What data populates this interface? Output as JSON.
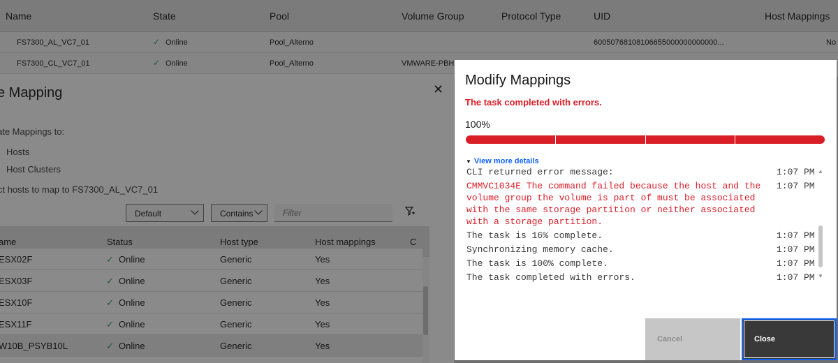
{
  "volumes_table": {
    "columns": [
      "Name",
      "State",
      "Pool",
      "Volume Group",
      "Protocol Type",
      "UID",
      "Host Mappings"
    ],
    "rows": [
      {
        "name": "FS7300_AL_VC7_01",
        "state": "Online",
        "pool": "Pool_Alterno",
        "volume_group": "",
        "uid": "60050768108106655000000000000...",
        "host_mappings": "No"
      },
      {
        "name": "FS7300_CL_VC7_01",
        "state": "Online",
        "pool": "Pool_Alterno",
        "volume_group": "VMWARE-PBHA"
      }
    ]
  },
  "create_mapping_dialog": {
    "title": "e Mapping",
    "map_to_label": "ate Mappings to:",
    "options": [
      "Hosts",
      "Host Clusters"
    ],
    "select_hosts_label": "ct hosts to map to FS7300_AL_VC7_01",
    "view_select": "Default",
    "filter_mode": "Contains",
    "filter_placeholder": "Filter",
    "columns": [
      "ame",
      "Status",
      "Host type",
      "Host mappings",
      "C"
    ],
    "rows": [
      {
        "name": "ESX02F",
        "status": "Online",
        "host_type": "Generic",
        "mappings": "Yes"
      },
      {
        "name": "ESX03F",
        "status": "Online",
        "host_type": "Generic",
        "mappings": "Yes"
      },
      {
        "name": "ESX10F",
        "status": "Online",
        "host_type": "Generic",
        "mappings": "Yes"
      },
      {
        "name": "ESX11F",
        "status": "Online",
        "host_type": "Generic",
        "mappings": "Yes"
      },
      {
        "name": "W10B_PSYB10L",
        "status": "Online",
        "host_type": "Generic",
        "mappings": "Yes"
      }
    ]
  },
  "modal": {
    "title": "Modify Mappings",
    "error_status": "The task completed with errors.",
    "progress_label": "100%",
    "progress_value": 1.0,
    "details_link": "View more details",
    "log": [
      {
        "message": "CLI returned error message:",
        "time": "1:07 PM",
        "error": false
      },
      {
        "message": "CMMVC1034E The command failed because the host and the volume group the volume is part of must be associated with the same storage partition or neither associated with a storage partition.",
        "time": "1:07 PM",
        "error": true
      },
      {
        "message": "The task is 16% complete.",
        "time": "1:07 PM",
        "error": false
      },
      {
        "message": "Synchronizing memory cache.",
        "time": "1:07 PM",
        "error": false
      },
      {
        "message": "The task is 100% complete.",
        "time": "1:07 PM",
        "error": false
      },
      {
        "message": "The task completed with errors.",
        "time": "1:07 PM",
        "error": false
      }
    ],
    "cancel_label": "Cancel",
    "close_label": "Close"
  },
  "colors": {
    "error_red": "#da1e28",
    "online_green": "#24a148",
    "link_blue": "#0f62fe",
    "primary_button": "#393939"
  }
}
